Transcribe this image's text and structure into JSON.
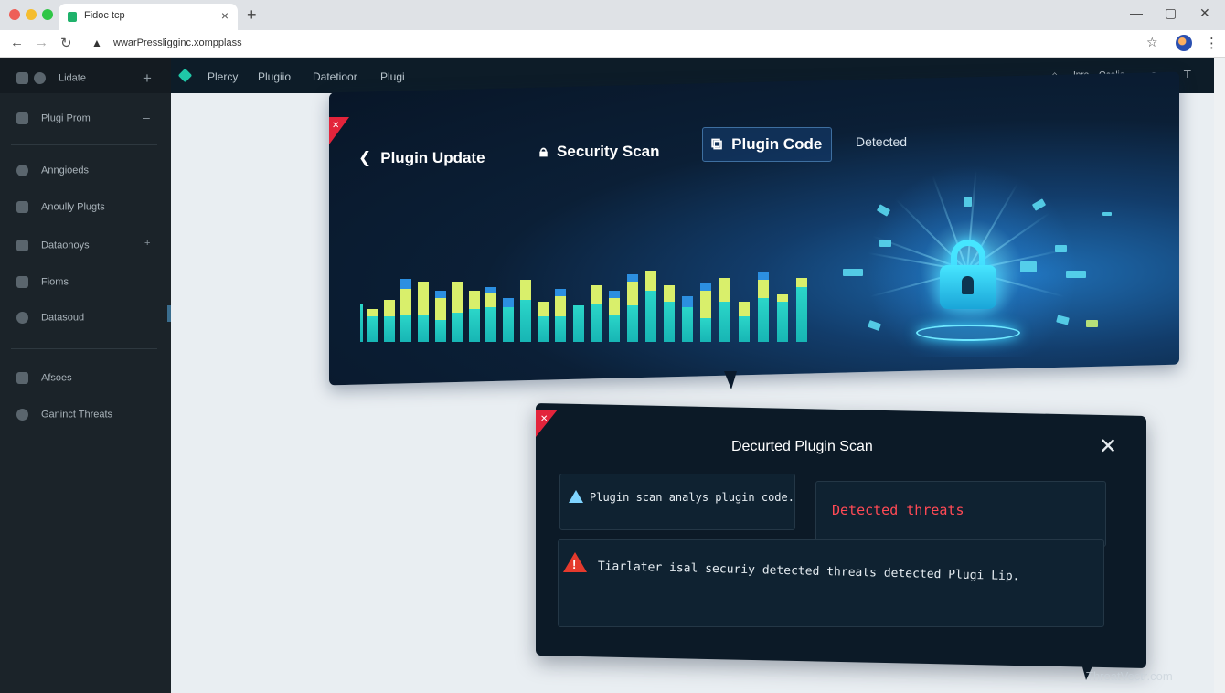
{
  "browser": {
    "tab_title": "Fidoc tcp",
    "url": "wwarPressligginc.xompplass",
    "icons": [
      "back-icon",
      "forward-icon",
      "reload-icon",
      "site-icon",
      "star-icon",
      "profile-avatar",
      "menu-icon",
      "minimize-icon",
      "maximize-icon",
      "close-icon"
    ]
  },
  "appbar": {
    "nav": [
      "Plercy",
      "Plugiio",
      "Datetioor",
      "Plugi"
    ],
    "right": [
      "Inre",
      "Ocalie"
    ]
  },
  "sidebar": {
    "header": "Lidate",
    "items": [
      {
        "label": "Plugi Prom"
      },
      {
        "label": "Anngioeds"
      },
      {
        "label": "Anoully Plugts"
      },
      {
        "label": "Dataonoys"
      },
      {
        "label": "Fioms"
      },
      {
        "label": "Datasoud"
      },
      {
        "label": "Afsoes"
      },
      {
        "label": "Ganinct Threats"
      }
    ]
  },
  "panel": {
    "tabs": [
      {
        "label": "Plugin Update",
        "icon": "chevron-left-icon"
      },
      {
        "label": "Security Scan",
        "icon": "lock-icon"
      },
      {
        "label": "Plugin Code",
        "icon": "code-icon"
      }
    ],
    "detected_label": "Detected",
    "colors": {
      "teal": "#22c9c2",
      "yellow": "#d9ef6b",
      "blue": "#2c8fe0"
    }
  },
  "dialog": {
    "title": "Decurted Plugin Scan",
    "info_text": "Plugin scan analys plugin code.",
    "threat_text": "Detected threats",
    "warning_text": "Tiarlater isal securiy detected threats detected Plugi Lip.",
    "accent_color": "#e3243b"
  },
  "watermark": "ThreatVectr.com"
}
